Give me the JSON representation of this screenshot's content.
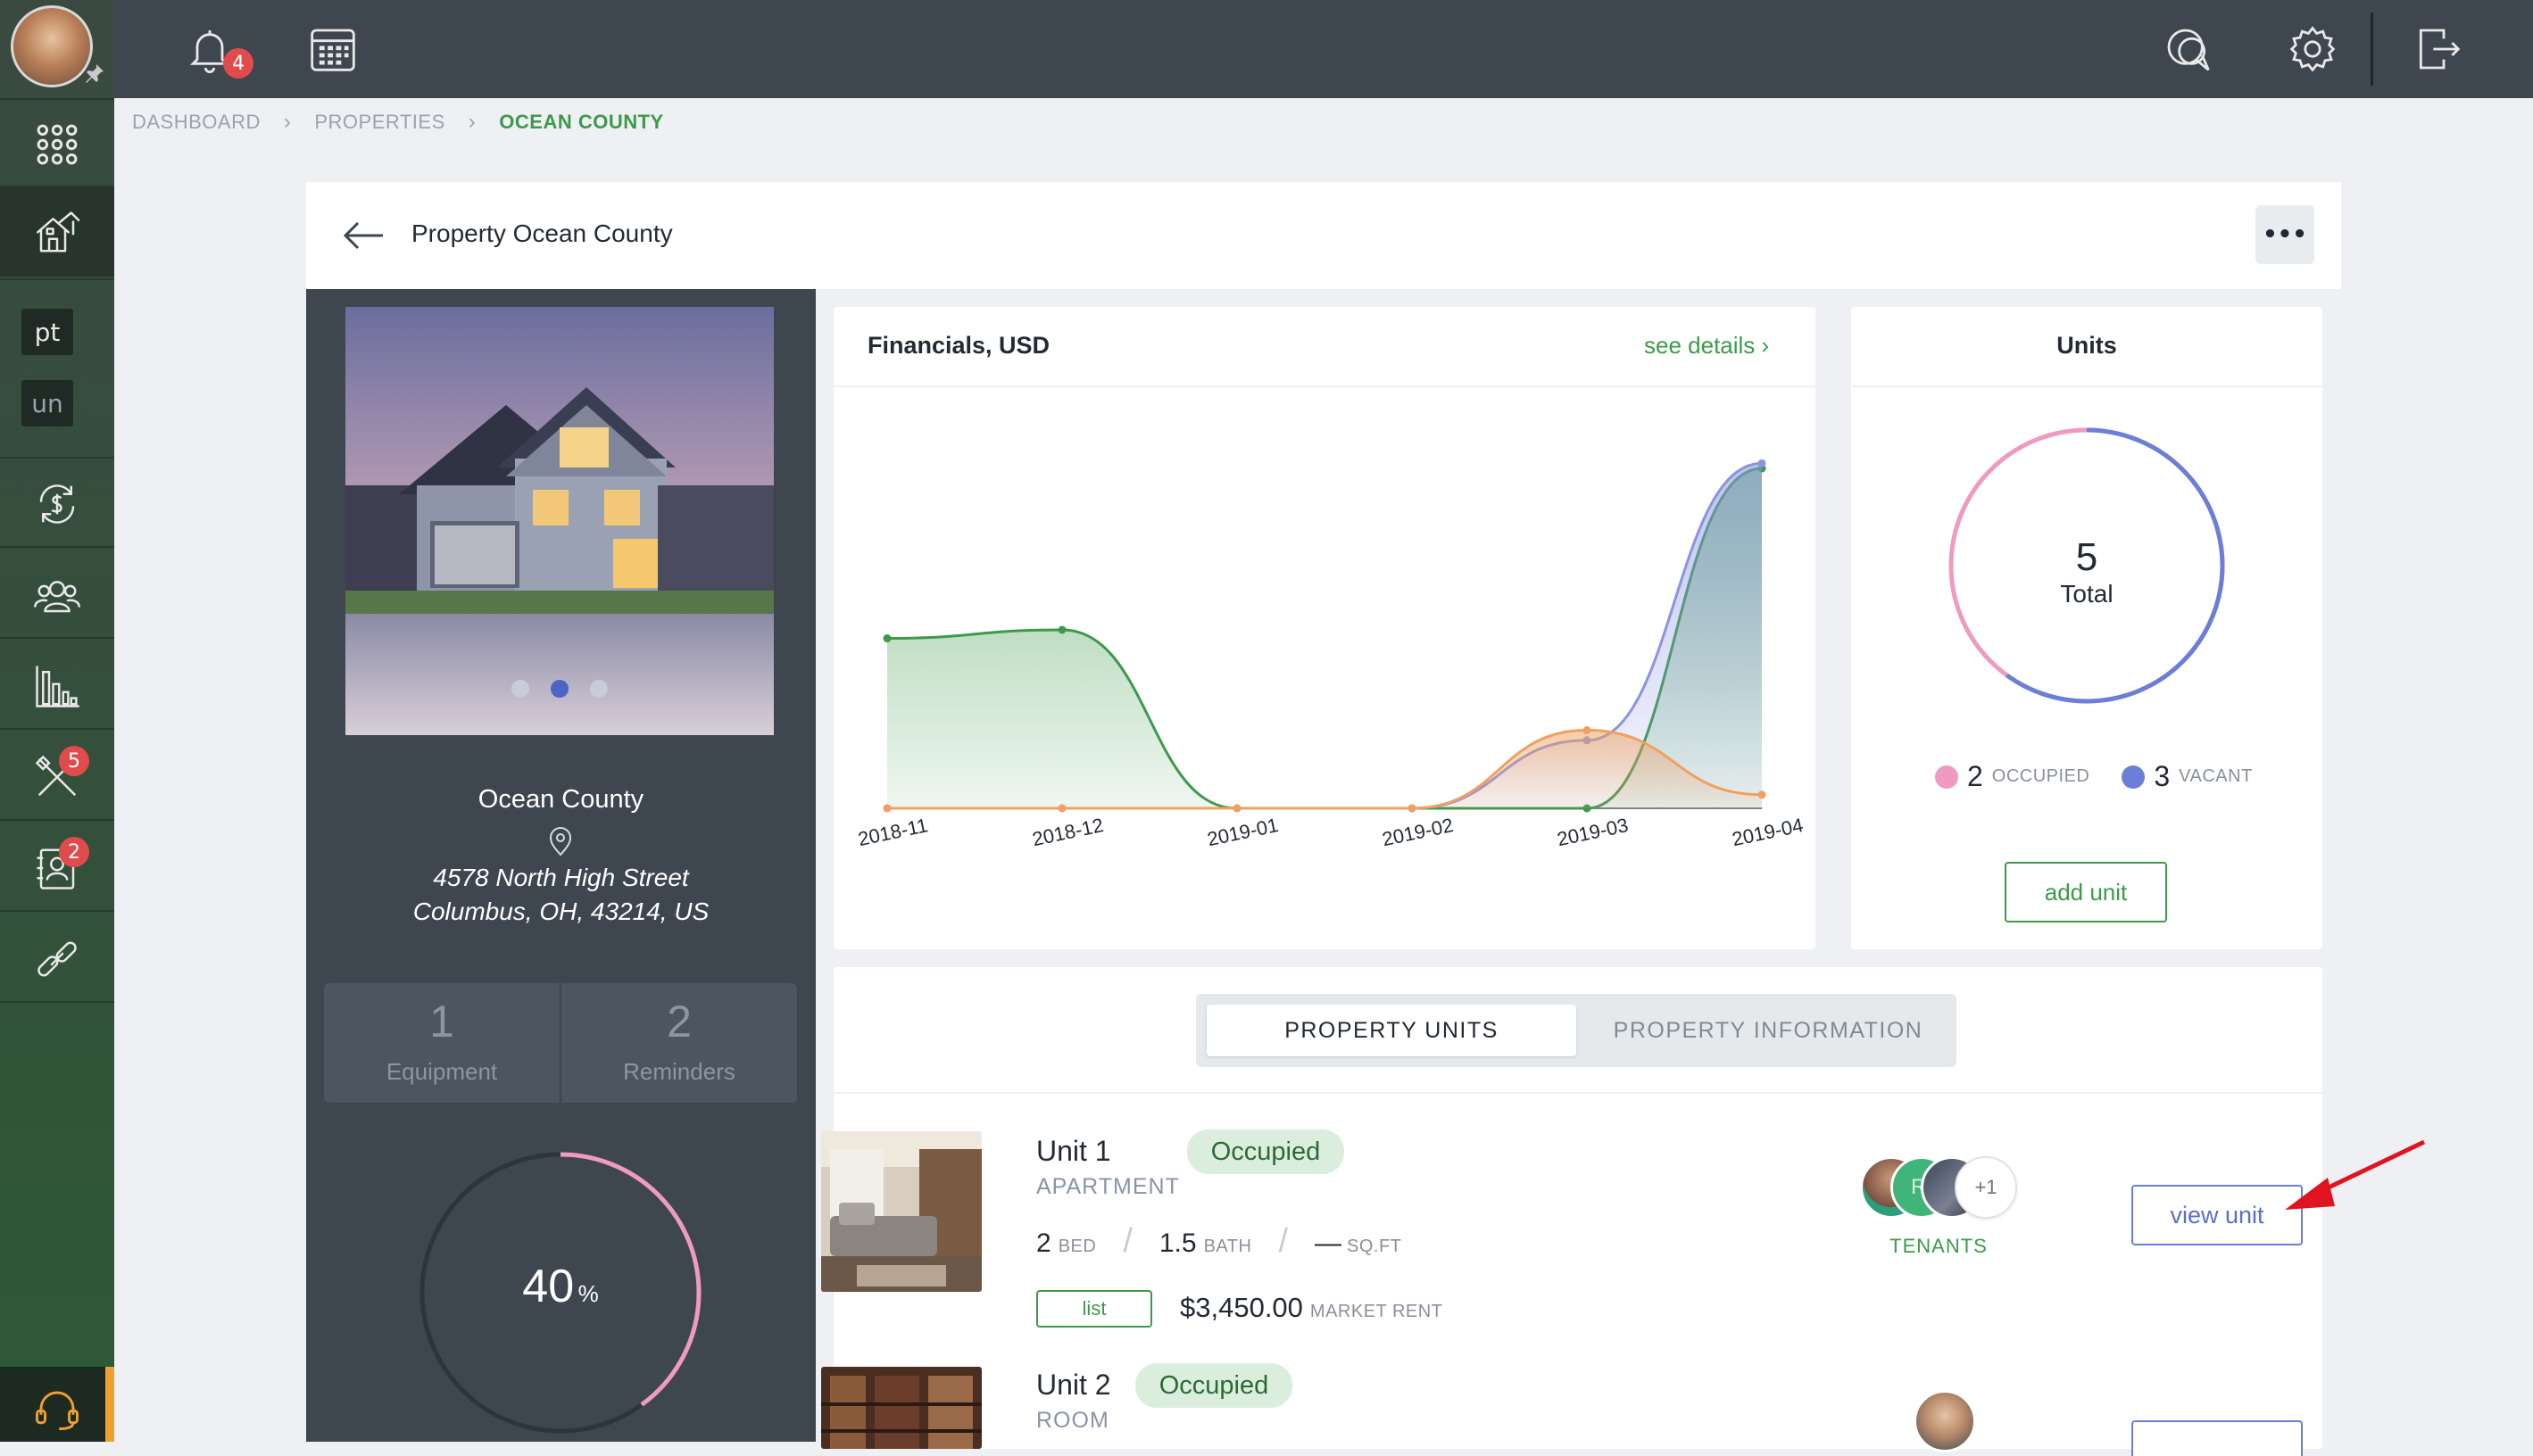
{
  "topbar": {
    "notification_count": "4",
    "icons": [
      "bell-icon",
      "calendar-icon",
      "chat-icon",
      "gear-icon",
      "logout-icon"
    ]
  },
  "sidebar": {
    "items": [
      "apps-grid-icon",
      "property-icon",
      "money-cycle-icon",
      "people-icon",
      "reports-icon",
      "tools-icon",
      "contacts-icon",
      "links-icon",
      "support-icon"
    ],
    "pt_label": "pt",
    "un_label": "un",
    "tools_badge": "5",
    "contacts_badge": "2"
  },
  "breadcrumb": {
    "items": [
      "DASHBOARD",
      "PROPERTIES",
      "OCEAN COUNTY"
    ]
  },
  "header": {
    "title": "Property Ocean County",
    "more_label": "•••"
  },
  "property": {
    "name": "Ocean County",
    "address_line1": "4578 North High Street",
    "address_line2": "Columbus, OH, 43214, US",
    "equipment_count": "1",
    "equipment_label": "Equipment",
    "reminders_count": "2",
    "reminders_label": "Reminders",
    "occupancy_percent": "40",
    "occupancy_unit": "%",
    "occupancy_fraction": 0.4
  },
  "financials": {
    "title": "Financials, USD",
    "link": "see details ›"
  },
  "chart_data": {
    "type": "area",
    "x": [
      "2018-11",
      "2018-12",
      "2019-01",
      "2019-02",
      "2019-03",
      "2019-04"
    ],
    "series": [
      {
        "values": [
          10,
          10.5,
          0,
          0,
          0,
          20
        ],
        "color": "#3c9a4a"
      },
      {
        "values": [
          0,
          0,
          0,
          0,
          4,
          20.3
        ],
        "color": "#8a94e0"
      },
      {
        "values": [
          0,
          0,
          0,
          0,
          4.6,
          0.8
        ],
        "color": "#f0a060"
      }
    ],
    "ylim": [
      0,
      21
    ],
    "grid": false,
    "legend": "none"
  },
  "units_card": {
    "title": "Units",
    "total": "5",
    "total_label": "Total",
    "occupied_count": "2",
    "occupied_label": "OCCUPIED",
    "vacant_count": "3",
    "vacant_label": "VACANT",
    "occupied_color": "#ef9ac0",
    "vacant_color": "#6b7fd9",
    "add_label": "add unit"
  },
  "tabs": {
    "units": "PROPERTY UNITS",
    "info": "PROPERTY INFORMATION"
  },
  "unit_rows": [
    {
      "name": "Unit 1",
      "type": "APARTMENT",
      "status": "Occupied",
      "bed": "2",
      "bed_label": "BED",
      "bath": "1.5",
      "bath_label": "BATH",
      "sqft": "—",
      "sqft_label": "SQ.FT",
      "list_label": "list",
      "rent": "$3,450.00",
      "rent_label": "MARKET RENT",
      "avatar_initials": "RI",
      "more_tenants": "+1",
      "tenants_label": "TENANTS",
      "view_label": "view unit"
    },
    {
      "name": "Unit 2",
      "type": "ROOM",
      "status": "Occupied"
    }
  ]
}
